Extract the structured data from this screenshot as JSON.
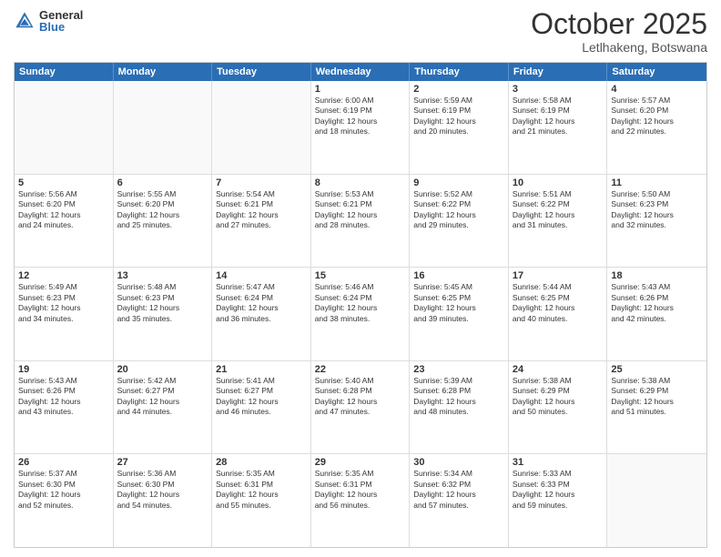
{
  "logo": {
    "general": "General",
    "blue": "Blue"
  },
  "title": "October 2025",
  "location": "Letlhakeng, Botswana",
  "header_days": [
    "Sunday",
    "Monday",
    "Tuesday",
    "Wednesday",
    "Thursday",
    "Friday",
    "Saturday"
  ],
  "rows": [
    [
      {
        "day": "",
        "text": ""
      },
      {
        "day": "",
        "text": ""
      },
      {
        "day": "",
        "text": ""
      },
      {
        "day": "1",
        "text": "Sunrise: 6:00 AM\nSunset: 6:19 PM\nDaylight: 12 hours\nand 18 minutes."
      },
      {
        "day": "2",
        "text": "Sunrise: 5:59 AM\nSunset: 6:19 PM\nDaylight: 12 hours\nand 20 minutes."
      },
      {
        "day": "3",
        "text": "Sunrise: 5:58 AM\nSunset: 6:19 PM\nDaylight: 12 hours\nand 21 minutes."
      },
      {
        "day": "4",
        "text": "Sunrise: 5:57 AM\nSunset: 6:20 PM\nDaylight: 12 hours\nand 22 minutes."
      }
    ],
    [
      {
        "day": "5",
        "text": "Sunrise: 5:56 AM\nSunset: 6:20 PM\nDaylight: 12 hours\nand 24 minutes."
      },
      {
        "day": "6",
        "text": "Sunrise: 5:55 AM\nSunset: 6:20 PM\nDaylight: 12 hours\nand 25 minutes."
      },
      {
        "day": "7",
        "text": "Sunrise: 5:54 AM\nSunset: 6:21 PM\nDaylight: 12 hours\nand 27 minutes."
      },
      {
        "day": "8",
        "text": "Sunrise: 5:53 AM\nSunset: 6:21 PM\nDaylight: 12 hours\nand 28 minutes."
      },
      {
        "day": "9",
        "text": "Sunrise: 5:52 AM\nSunset: 6:22 PM\nDaylight: 12 hours\nand 29 minutes."
      },
      {
        "day": "10",
        "text": "Sunrise: 5:51 AM\nSunset: 6:22 PM\nDaylight: 12 hours\nand 31 minutes."
      },
      {
        "day": "11",
        "text": "Sunrise: 5:50 AM\nSunset: 6:23 PM\nDaylight: 12 hours\nand 32 minutes."
      }
    ],
    [
      {
        "day": "12",
        "text": "Sunrise: 5:49 AM\nSunset: 6:23 PM\nDaylight: 12 hours\nand 34 minutes."
      },
      {
        "day": "13",
        "text": "Sunrise: 5:48 AM\nSunset: 6:23 PM\nDaylight: 12 hours\nand 35 minutes."
      },
      {
        "day": "14",
        "text": "Sunrise: 5:47 AM\nSunset: 6:24 PM\nDaylight: 12 hours\nand 36 minutes."
      },
      {
        "day": "15",
        "text": "Sunrise: 5:46 AM\nSunset: 6:24 PM\nDaylight: 12 hours\nand 38 minutes."
      },
      {
        "day": "16",
        "text": "Sunrise: 5:45 AM\nSunset: 6:25 PM\nDaylight: 12 hours\nand 39 minutes."
      },
      {
        "day": "17",
        "text": "Sunrise: 5:44 AM\nSunset: 6:25 PM\nDaylight: 12 hours\nand 40 minutes."
      },
      {
        "day": "18",
        "text": "Sunrise: 5:43 AM\nSunset: 6:26 PM\nDaylight: 12 hours\nand 42 minutes."
      }
    ],
    [
      {
        "day": "19",
        "text": "Sunrise: 5:43 AM\nSunset: 6:26 PM\nDaylight: 12 hours\nand 43 minutes."
      },
      {
        "day": "20",
        "text": "Sunrise: 5:42 AM\nSunset: 6:27 PM\nDaylight: 12 hours\nand 44 minutes."
      },
      {
        "day": "21",
        "text": "Sunrise: 5:41 AM\nSunset: 6:27 PM\nDaylight: 12 hours\nand 46 minutes."
      },
      {
        "day": "22",
        "text": "Sunrise: 5:40 AM\nSunset: 6:28 PM\nDaylight: 12 hours\nand 47 minutes."
      },
      {
        "day": "23",
        "text": "Sunrise: 5:39 AM\nSunset: 6:28 PM\nDaylight: 12 hours\nand 48 minutes."
      },
      {
        "day": "24",
        "text": "Sunrise: 5:38 AM\nSunset: 6:29 PM\nDaylight: 12 hours\nand 50 minutes."
      },
      {
        "day": "25",
        "text": "Sunrise: 5:38 AM\nSunset: 6:29 PM\nDaylight: 12 hours\nand 51 minutes."
      }
    ],
    [
      {
        "day": "26",
        "text": "Sunrise: 5:37 AM\nSunset: 6:30 PM\nDaylight: 12 hours\nand 52 minutes."
      },
      {
        "day": "27",
        "text": "Sunrise: 5:36 AM\nSunset: 6:30 PM\nDaylight: 12 hours\nand 54 minutes."
      },
      {
        "day": "28",
        "text": "Sunrise: 5:35 AM\nSunset: 6:31 PM\nDaylight: 12 hours\nand 55 minutes."
      },
      {
        "day": "29",
        "text": "Sunrise: 5:35 AM\nSunset: 6:31 PM\nDaylight: 12 hours\nand 56 minutes."
      },
      {
        "day": "30",
        "text": "Sunrise: 5:34 AM\nSunset: 6:32 PM\nDaylight: 12 hours\nand 57 minutes."
      },
      {
        "day": "31",
        "text": "Sunrise: 5:33 AM\nSunset: 6:33 PM\nDaylight: 12 hours\nand 59 minutes."
      },
      {
        "day": "",
        "text": ""
      }
    ]
  ]
}
